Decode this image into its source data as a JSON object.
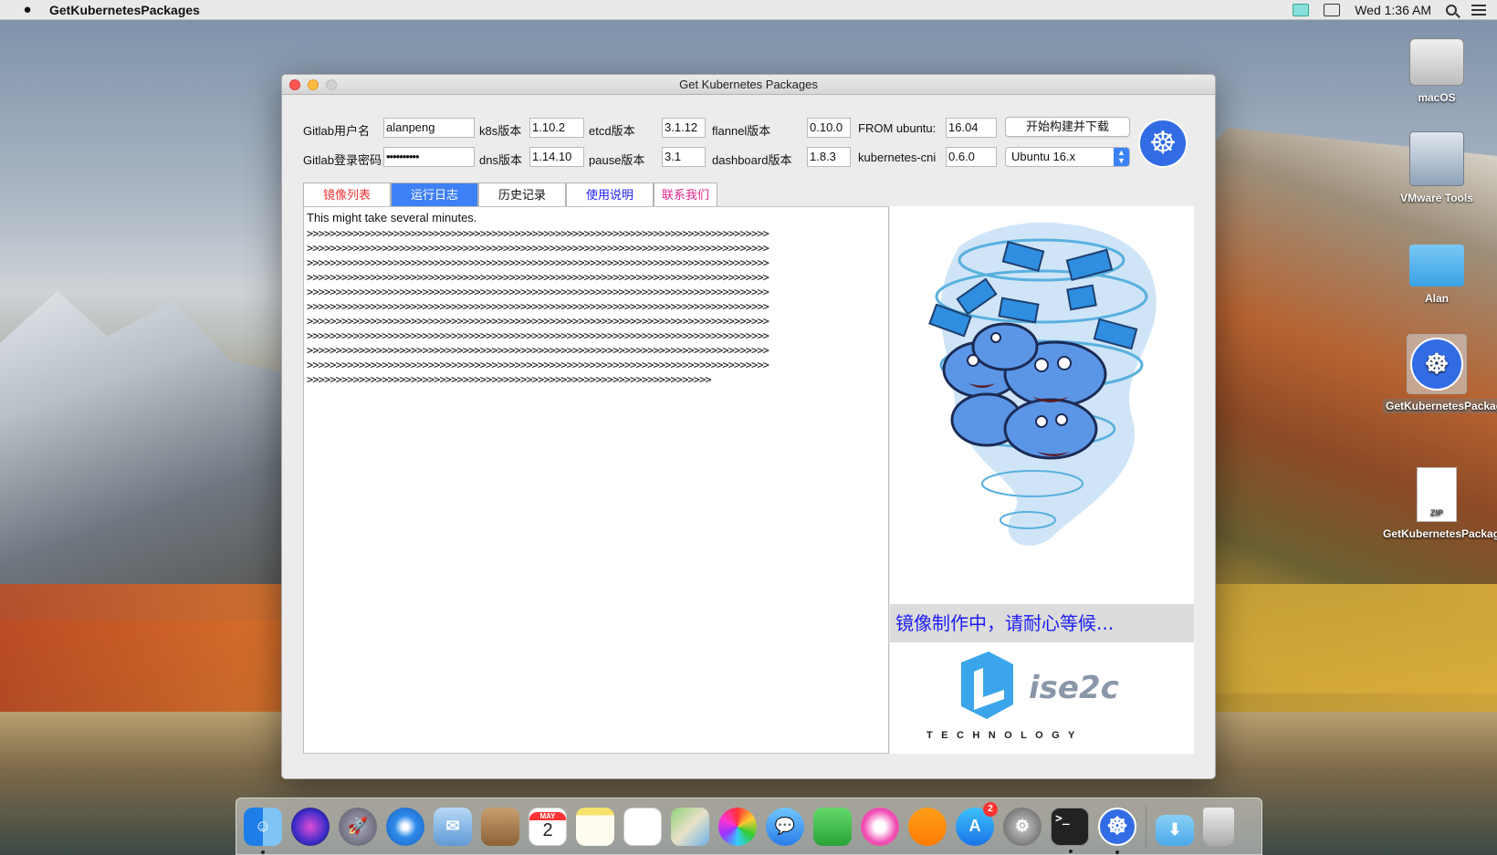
{
  "menubar": {
    "app_name": "GetKubernetesPackages",
    "clock": "Wed 1:36 AM"
  },
  "desktop_icons": [
    {
      "label": "macOS",
      "icon": "hard-drive-icon"
    },
    {
      "label": "VMware Tools",
      "icon": "vmware-tools-icon"
    },
    {
      "label": "Alan",
      "icon": "folder-icon"
    },
    {
      "label": "GetKubernetesPackages",
      "icon": "kubernetes-app-icon"
    },
    {
      "label": "GetKubernetesPackages.zip",
      "icon": "zip-file-icon"
    }
  ],
  "window": {
    "title": "Get Kubernetes Packages",
    "form": {
      "gitlab_user_label": "Gitlab用户名",
      "gitlab_user_value": "alanpeng",
      "gitlab_pass_label": "Gitlab登录密码",
      "gitlab_pass_value": "••••••••••",
      "k8s_label": "k8s版本",
      "k8s_value": "1.10.2",
      "dns_label": "dns版本",
      "dns_value": "1.14.10",
      "etcd_label": "etcd版本",
      "etcd_value": "3.1.12",
      "pause_label": "pause版本",
      "pause_value": "3.1",
      "flannel_label": "flannel版本",
      "flannel_value": "0.10.0",
      "dashboard_label": "dashboard版本",
      "dashboard_value": "1.8.3",
      "from_ubuntu_label": "FROM ubuntu:",
      "from_ubuntu_value": "16.04",
      "cni_label": "kubernetes-cni",
      "cni_value": "0.6.0",
      "build_button": "开始构建并下载",
      "ubuntu_select": "Ubuntu 16.x"
    },
    "tabs": [
      {
        "label": "镜像列表",
        "color": "#ee3333"
      },
      {
        "label": "运行日志",
        "color": "#ffffff"
      },
      {
        "label": "历史记录",
        "color": "#111111"
      },
      {
        "label": "使用说明",
        "color": "#1d1df5"
      },
      {
        "label": "联系我们",
        "color": "#e0228a"
      }
    ],
    "log": {
      "first_line": "This might take several minutes.",
      "lines": [
        ">>>>>>>>>>>>>>>>>>>>>>>>>>>>>>>>>>>>>>>>>>>>>>>>>>>>>>>>>>>>>>>>>>>>>>>>>>>>>>>>",
        ">>>>>>>>>>>>>>>>>>>>>>>>>>>>>>>>>>>>>>>>>>>>>>>>>>>>>>>>>>>>>>>>>>>>>>>>>>>>>>>>",
        ">>>>>>>>>>>>>>>>>>>>>>>>>>>>>>>>>>>>>>>>>>>>>>>>>>>>>>>>>>>>>>>>>>>>>>>>>>>>>>>>",
        ">>>>>>>>>>>>>>>>>>>>>>>>>>>>>>>>>>>>>>>>>>>>>>>>>>>>>>>>>>>>>>>>>>>>>>>>>>>>>>>>",
        ">>>>>>>>>>>>>>>>>>>>>>>>>>>>>>>>>>>>>>>>>>>>>>>>>>>>>>>>>>>>>>>>>>>>>>>>>>>>>>>>",
        ">>>>>>>>>>>>>>>>>>>>>>>>>>>>>>>>>>>>>>>>>>>>>>>>>>>>>>>>>>>>>>>>>>>>>>>>>>>>>>>>",
        ">>>>>>>>>>>>>>>>>>>>>>>>>>>>>>>>>>>>>>>>>>>>>>>>>>>>>>>>>>>>>>>>>>>>>>>>>>>>>>>>",
        ">>>>>>>>>>>>>>>>>>>>>>>>>>>>>>>>>>>>>>>>>>>>>>>>>>>>>>>>>>>>>>>>>>>>>>>>>>>>>>>>",
        ">>>>>>>>>>>>>>>>>>>>>>>>>>>>>>>>>>>>>>>>>>>>>>>>>>>>>>>>>>>>>>>>>>>>>>>>>>>>>>>>",
        ">>>>>>>>>>>>>>>>>>>>>>>>>>>>>>>>>>>>>>>>>>>>>>>>>>>>>>>>>>>>>>>>>>>>>>>>>>>>>>>>",
        ">>>>>>>>>>>>>>>>>>>>>>>>>>>>>>>>>>>>>>>>>>>>>>>>>>>>>>>>>>>>>>>>>>>>>>"
      ]
    },
    "status_text": "镜像制作中，请耐心等候...",
    "logo": {
      "main": "ise2c",
      "sub": "T E C H N O L O G Y"
    }
  },
  "dock": {
    "calendar_month": "MAY",
    "calendar_day": "2",
    "appstore_badge": "2",
    "items": [
      "finder-icon",
      "siri-icon",
      "launchpad-icon",
      "safari-icon",
      "mail-icon",
      "contacts-icon",
      "calendar-icon",
      "notes-icon",
      "reminders-icon",
      "maps-icon",
      "photos-icon",
      "messages-icon",
      "facetime-icon",
      "itunes-icon",
      "ibooks-icon",
      "app-store-icon",
      "system-preferences-icon",
      "terminal-icon",
      "kubernetes-app-icon",
      "downloads-folder-icon",
      "trash-icon"
    ]
  },
  "colors": {
    "accent": "#3e80f5",
    "status_blue": "#1d1df5",
    "k8s_blue": "#326ce5"
  }
}
